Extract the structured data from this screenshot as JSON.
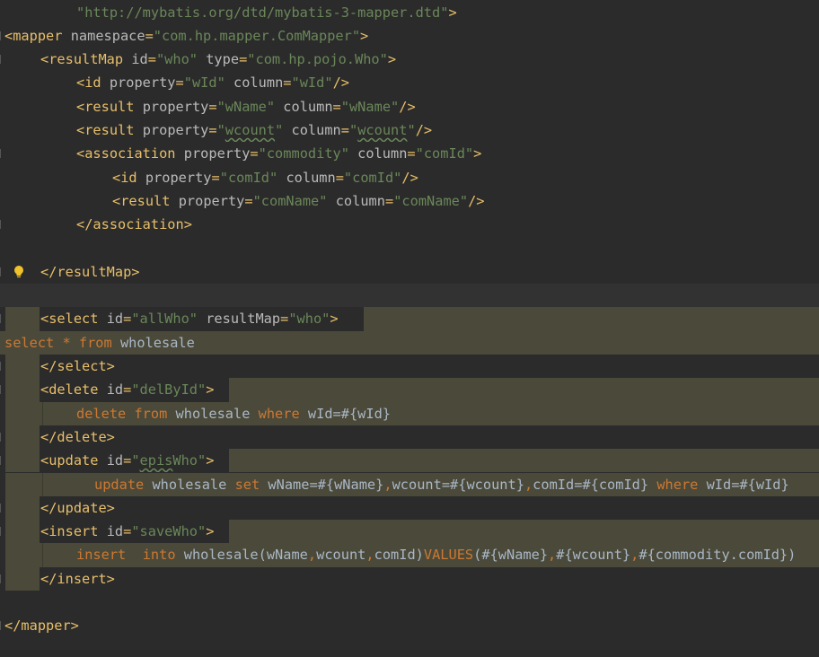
{
  "editor": {
    "language": "xml",
    "colors": {
      "background": "#2b2b2b",
      "tag": "#e8bf6a",
      "attribute": "#bababa",
      "string": "#6a8759",
      "keyword": "#cc7832",
      "text": "#a9b7c6",
      "injection_highlight": "#4b4a3a"
    },
    "lines": [
      {
        "tokens": [
          {
            "t": "val",
            "v": "\"http://mybatis.org/dtd/mybatis-3-mapper.dtd\""
          },
          {
            "t": "tag",
            "v": ">"
          }
        ]
      },
      {
        "tokens": [
          {
            "t": "tag",
            "v": "<mapper "
          },
          {
            "t": "attr",
            "v": "namespace"
          },
          {
            "t": "tag",
            "v": "="
          },
          {
            "t": "val",
            "v": "\"com.hp.mapper.ComMapper\""
          },
          {
            "t": "tag",
            "v": ">"
          }
        ]
      },
      {
        "tokens": [
          {
            "t": "tag",
            "v": "<resultMap "
          },
          {
            "t": "attr",
            "v": "id"
          },
          {
            "t": "tag",
            "v": "="
          },
          {
            "t": "val",
            "v": "\"who\" "
          },
          {
            "t": "attr",
            "v": "type"
          },
          {
            "t": "tag",
            "v": "="
          },
          {
            "t": "val",
            "v": "\"com.hp.pojo.Who\""
          },
          {
            "t": "tag",
            "v": ">"
          }
        ]
      },
      {
        "tokens": [
          {
            "t": "tag",
            "v": "<id "
          },
          {
            "t": "attr",
            "v": "property"
          },
          {
            "t": "tag",
            "v": "="
          },
          {
            "t": "val",
            "v": "\"wId\" "
          },
          {
            "t": "attr",
            "v": "column"
          },
          {
            "t": "tag",
            "v": "="
          },
          {
            "t": "val",
            "v": "\"wId\""
          },
          {
            "t": "tag",
            "v": "/>"
          }
        ]
      },
      {
        "tokens": [
          {
            "t": "tag",
            "v": "<result "
          },
          {
            "t": "attr",
            "v": "property"
          },
          {
            "t": "tag",
            "v": "="
          },
          {
            "t": "val",
            "v": "\"wName\" "
          },
          {
            "t": "attr",
            "v": "column"
          },
          {
            "t": "tag",
            "v": "="
          },
          {
            "t": "val",
            "v": "\"wName\""
          },
          {
            "t": "tag",
            "v": "/>"
          }
        ]
      },
      {
        "tokens": [
          {
            "t": "tag",
            "v": "<result "
          },
          {
            "t": "attr",
            "v": "property"
          },
          {
            "t": "tag",
            "v": "="
          },
          {
            "t": "val",
            "v": "\""
          },
          {
            "t": "val squig",
            "v": "wcount"
          },
          {
            "t": "val",
            "v": "\" "
          },
          {
            "t": "attr",
            "v": "column"
          },
          {
            "t": "tag",
            "v": "="
          },
          {
            "t": "val",
            "v": "\""
          },
          {
            "t": "val squig",
            "v": "wcount"
          },
          {
            "t": "val",
            "v": "\""
          },
          {
            "t": "tag",
            "v": "/>"
          }
        ]
      },
      {
        "tokens": [
          {
            "t": "tag",
            "v": "<association "
          },
          {
            "t": "attr",
            "v": "property"
          },
          {
            "t": "tag",
            "v": "="
          },
          {
            "t": "val",
            "v": "\"commodity\" "
          },
          {
            "t": "attr",
            "v": "column"
          },
          {
            "t": "tag",
            "v": "="
          },
          {
            "t": "val",
            "v": "\"comId\""
          },
          {
            "t": "tag",
            "v": ">"
          }
        ]
      },
      {
        "tokens": [
          {
            "t": "tag",
            "v": "<id "
          },
          {
            "t": "attr",
            "v": "property"
          },
          {
            "t": "tag",
            "v": "="
          },
          {
            "t": "val",
            "v": "\"comId\" "
          },
          {
            "t": "attr",
            "v": "column"
          },
          {
            "t": "tag",
            "v": "="
          },
          {
            "t": "val",
            "v": "\"comId\""
          },
          {
            "t": "tag",
            "v": "/>"
          }
        ]
      },
      {
        "tokens": [
          {
            "t": "tag",
            "v": "<result "
          },
          {
            "t": "attr",
            "v": "property"
          },
          {
            "t": "tag",
            "v": "="
          },
          {
            "t": "val",
            "v": "\"comName\" "
          },
          {
            "t": "attr",
            "v": "column"
          },
          {
            "t": "tag",
            "v": "="
          },
          {
            "t": "val",
            "v": "\"comName\""
          },
          {
            "t": "tag",
            "v": "/>"
          }
        ]
      },
      {
        "tokens": [
          {
            "t": "tag",
            "v": "</association>"
          }
        ]
      },
      {
        "tokens": []
      },
      {
        "tokens": [
          {
            "t": "tag",
            "v": "</resultMap>"
          }
        ]
      },
      {
        "tokens": []
      },
      {
        "tokens": [
          {
            "t": "tag",
            "v": "<select "
          },
          {
            "t": "attr",
            "v": "id"
          },
          {
            "t": "tag",
            "v": "="
          },
          {
            "t": "val",
            "v": "\"allWho\" "
          },
          {
            "t": "attr",
            "v": "resultMap"
          },
          {
            "t": "tag",
            "v": "="
          },
          {
            "t": "val",
            "v": "\"who\""
          },
          {
            "t": "tag",
            "v": ">"
          }
        ]
      },
      {
        "tokens": [
          {
            "t": "kw",
            "v": "select "
          },
          {
            "t": "kw",
            "v": "* "
          },
          {
            "t": "kw",
            "v": "from "
          },
          {
            "t": "plain",
            "v": "wholesale"
          }
        ]
      },
      {
        "tokens": [
          {
            "t": "tag",
            "v": "</select>"
          }
        ]
      },
      {
        "tokens": [
          {
            "t": "tag",
            "v": "<delete "
          },
          {
            "t": "attr",
            "v": "id"
          },
          {
            "t": "tag",
            "v": "="
          },
          {
            "t": "val",
            "v": "\"delById\""
          },
          {
            "t": "tag",
            "v": ">"
          }
        ]
      },
      {
        "tokens": [
          {
            "t": "kw",
            "v": "delete "
          },
          {
            "t": "kw",
            "v": "from "
          },
          {
            "t": "plain",
            "v": "wholesale "
          },
          {
            "t": "kw",
            "v": "where "
          },
          {
            "t": "plain",
            "v": "wId=#{wId}"
          }
        ]
      },
      {
        "tokens": [
          {
            "t": "tag",
            "v": "</delete>"
          }
        ]
      },
      {
        "tokens": [
          {
            "t": "tag",
            "v": "<update "
          },
          {
            "t": "attr",
            "v": "id"
          },
          {
            "t": "tag",
            "v": "="
          },
          {
            "t": "val",
            "v": "\""
          },
          {
            "t": "val squig",
            "v": "epis"
          },
          {
            "t": "val",
            "v": "Who\""
          },
          {
            "t": "tag",
            "v": ">"
          }
        ]
      },
      {
        "tokens": [
          {
            "t": "kw",
            "v": "update "
          },
          {
            "t": "plain",
            "v": "wholesale "
          },
          {
            "t": "kw",
            "v": "set "
          },
          {
            "t": "plain",
            "v": "wName=#{wName}"
          },
          {
            "t": "kw",
            "v": ","
          },
          {
            "t": "plain",
            "v": "wcount=#{wcount}"
          },
          {
            "t": "kw",
            "v": ","
          },
          {
            "t": "plain",
            "v": "comId=#{comId} "
          },
          {
            "t": "kw",
            "v": "where "
          },
          {
            "t": "plain",
            "v": "wId=#{wId}"
          }
        ]
      },
      {
        "tokens": [
          {
            "t": "tag",
            "v": "</update>"
          }
        ]
      },
      {
        "tokens": [
          {
            "t": "tag",
            "v": "<insert "
          },
          {
            "t": "attr",
            "v": "id"
          },
          {
            "t": "tag",
            "v": "="
          },
          {
            "t": "val",
            "v": "\"saveWho\""
          },
          {
            "t": "tag",
            "v": ">"
          }
        ]
      },
      {
        "tokens": [
          {
            "t": "kw",
            "v": "insert  "
          },
          {
            "t": "kw",
            "v": "into "
          },
          {
            "t": "plain",
            "v": "wholesale(wName"
          },
          {
            "t": "kw",
            "v": ","
          },
          {
            "t": "plain",
            "v": "wcount"
          },
          {
            "t": "kw",
            "v": ","
          },
          {
            "t": "plain",
            "v": "comId)"
          },
          {
            "t": "kw",
            "v": "VALUES"
          },
          {
            "t": "plain",
            "v": "(#{wName}"
          },
          {
            "t": "kw",
            "v": ","
          },
          {
            "t": "plain",
            "v": "#{wcount}"
          },
          {
            "t": "kw",
            "v": ","
          },
          {
            "t": "plain",
            "v": "#{commodity.comId})"
          }
        ]
      },
      {
        "tokens": [
          {
            "t": "tag",
            "v": "</insert>"
          }
        ]
      },
      {
        "tokens": []
      },
      {
        "tokens": [
          {
            "t": "tag",
            "v": "</mapper>"
          }
        ]
      }
    ],
    "gutter_icons": [
      {
        "line": 11,
        "icon": "intention-bulb-icon"
      }
    ]
  }
}
